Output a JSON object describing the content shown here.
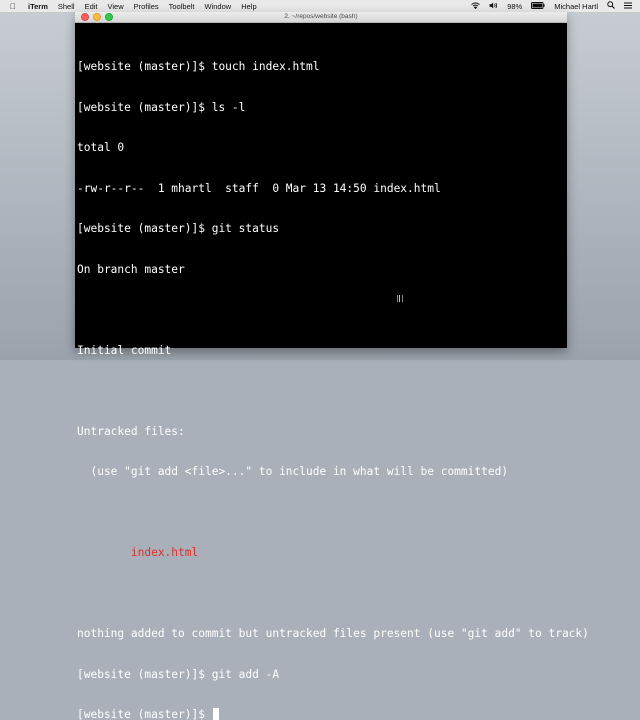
{
  "menubar": {
    "apple_icon": "apple-icon",
    "app_name": "iTerm",
    "items": [
      "Shell",
      "Edit",
      "View",
      "Profiles",
      "Toolbelt",
      "Window",
      "Help"
    ],
    "battery": "98%",
    "user": "Michael Hartl"
  },
  "window": {
    "title": "2. ~/repos/website (bash)"
  },
  "terminal": {
    "lines": [
      "[website (master)]$ touch index.html",
      "[website (master)]$ ls -l",
      "total 0",
      "-rw-r--r--  1 mhartl  staff  0 Mar 13 14:50 index.html",
      "[website (master)]$ git status",
      "On branch master",
      "",
      "Initial commit",
      "",
      "Untracked files:",
      "  (use \"git add <file>...\" to include in what will be committed)",
      "",
      "        index.html",
      "",
      "nothing added to commit but untracked files present (use \"git add\" to track)",
      "[website (master)]$ git add -A",
      "[website (master)]$ "
    ],
    "untracked_color": "#e0302a"
  }
}
